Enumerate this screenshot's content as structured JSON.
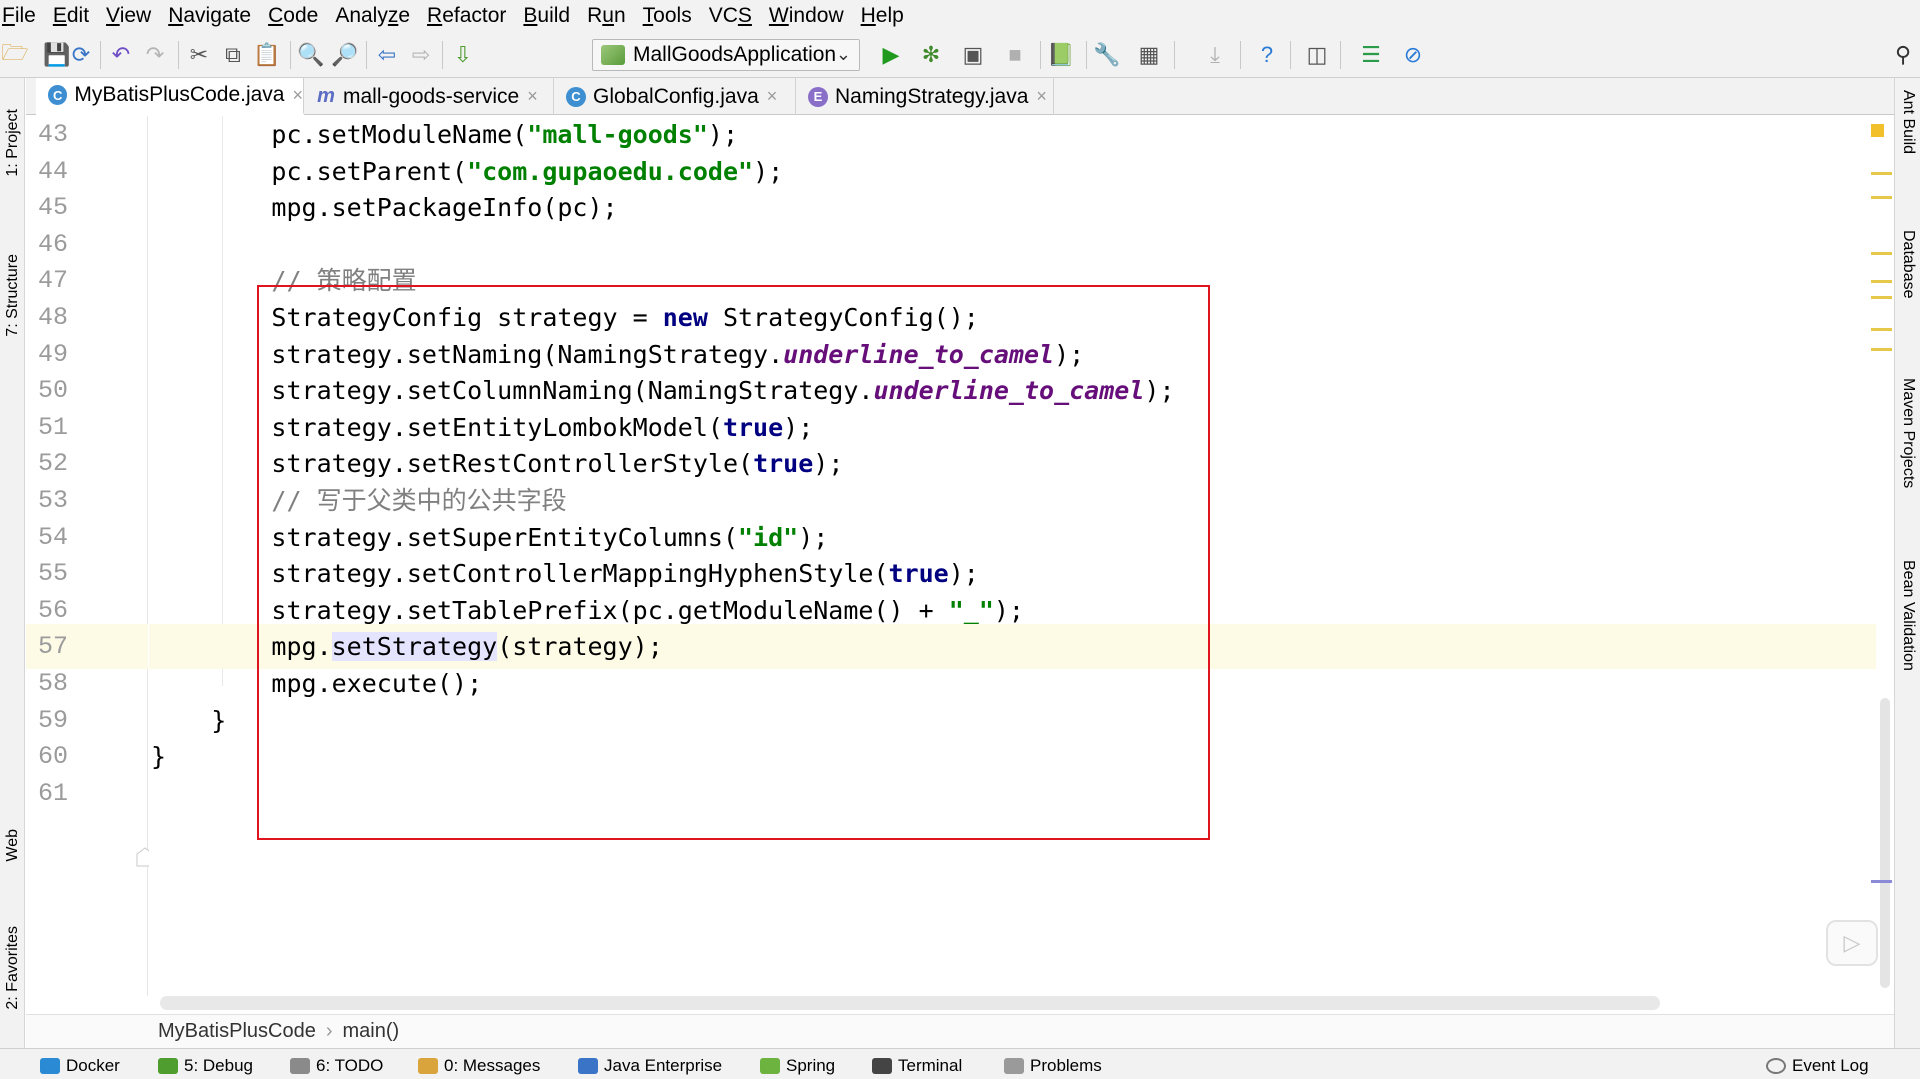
{
  "menu": [
    "File",
    "Edit",
    "View",
    "Navigate",
    "Code",
    "Analyze",
    "Refactor",
    "Build",
    "Run",
    "Tools",
    "VCS",
    "Window",
    "Help"
  ],
  "menu_mnemonics": [
    "F",
    "E",
    "V",
    "N",
    "C",
    "z",
    "R",
    "B",
    "u",
    "T",
    "S",
    "W",
    "H"
  ],
  "toolbar": {
    "run_config": "MallGoodsApplication"
  },
  "tabs": [
    {
      "label": "MyBatisPlusCode.java",
      "icon": "C",
      "color": "#3d8fd1",
      "active": true
    },
    {
      "label": "mall-goods-service",
      "icon": "m",
      "color": "#5b6ec4",
      "active": false
    },
    {
      "label": "GlobalConfig.java",
      "icon": "C",
      "color": "#3d8fd1",
      "active": false
    },
    {
      "label": "NamingStrategy.java",
      "icon": "E",
      "color": "#8a6fc9",
      "active": false
    }
  ],
  "left_tools": [
    "1: Project",
    "7: Structure",
    "Web",
    "2: Favorites"
  ],
  "right_tools": [
    "Ant Build",
    "Database",
    "Maven Projects",
    "Bean Validation"
  ],
  "line_numbers": [
    "43",
    "44",
    "45",
    "46",
    "47",
    "48",
    "49",
    "50",
    "51",
    "52",
    "53",
    "54",
    "55",
    "56",
    "57",
    "58",
    "59",
    "60",
    "61"
  ],
  "current_line": "57",
  "code_lines": [
    [
      {
        "t": "        pc.setModuleName("
      },
      {
        "t": "\"mall-goods\"",
        "c": "str"
      },
      {
        "t": ");"
      }
    ],
    [
      {
        "t": "        pc.setParent("
      },
      {
        "t": "\"com.gupaoedu.code\"",
        "c": "str"
      },
      {
        "t": ");"
      }
    ],
    [
      {
        "t": "        mpg.setPackageInfo(pc);"
      }
    ],
    [],
    [
      {
        "t": "        // 策略配置",
        "c": "cmt"
      }
    ],
    [
      {
        "t": "        StrategyConfig strategy = "
      },
      {
        "t": "new",
        "c": "kw"
      },
      {
        "t": " StrategyConfig();"
      }
    ],
    [
      {
        "t": "        strategy.setNaming(NamingStrategy."
      },
      {
        "t": "underline_to_camel",
        "c": "fld"
      },
      {
        "t": ");"
      }
    ],
    [
      {
        "t": "        strategy.setColumnNaming(NamingStrategy."
      },
      {
        "t": "underline_to_camel",
        "c": "fld"
      },
      {
        "t": ");"
      }
    ],
    [
      {
        "t": "        strategy.setEntityLombokModel("
      },
      {
        "t": "true",
        "c": "kw"
      },
      {
        "t": ");"
      }
    ],
    [
      {
        "t": "        strategy.setRestControllerStyle("
      },
      {
        "t": "true",
        "c": "kw"
      },
      {
        "t": ");"
      }
    ],
    [
      {
        "t": "        // 写于父类中的公共字段",
        "c": "cmt"
      }
    ],
    [
      {
        "t": "        strategy.setSuperEntityColumns("
      },
      {
        "t": "\"id\"",
        "c": "str"
      },
      {
        "t": ");"
      }
    ],
    [
      {
        "t": "        strategy.setControllerMappingHyphenStyle("
      },
      {
        "t": "true",
        "c": "kw"
      },
      {
        "t": ");"
      }
    ],
    [
      {
        "t": "        strategy.setTablePrefix(pc.getModuleName() + "
      },
      {
        "t": "\"_\"",
        "c": "str"
      },
      {
        "t": ");"
      }
    ],
    [
      {
        "t": "        mpg."
      },
      {
        "t": "setStrategy",
        "c": "hl"
      },
      {
        "t": "(strategy);"
      }
    ],
    [
      {
        "t": "        mpg.execute();"
      }
    ],
    [
      {
        "t": "    }"
      }
    ],
    [
      {
        "t": "}"
      }
    ],
    []
  ],
  "breadcrumb": [
    "MyBatisPlusCode",
    "main()"
  ],
  "bottom_tools": [
    {
      "label": "Docker",
      "color": "#2a8ad4"
    },
    {
      "label": "5: Debug",
      "color": "#4f9d2e"
    },
    {
      "label": "6: TODO",
      "color": "#8a8a8a"
    },
    {
      "label": "0: Messages",
      "color": "#d9a43b"
    },
    {
      "label": "Java Enterprise",
      "color": "#3a74c7"
    },
    {
      "label": "Spring",
      "color": "#6cb33f"
    },
    {
      "label": "Terminal",
      "color": "#444444"
    },
    {
      "label": "Problems",
      "color": "#9a9a9a"
    },
    {
      "label": "Event Log",
      "color": "#777777"
    }
  ]
}
